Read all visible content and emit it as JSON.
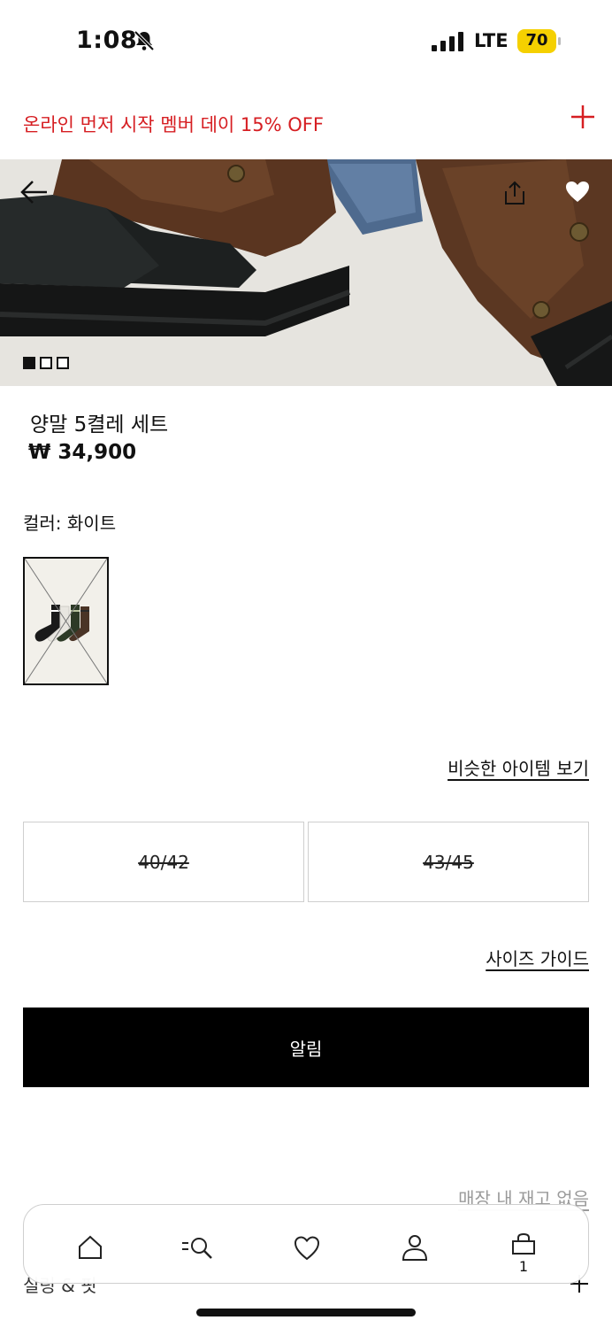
{
  "status_bar": {
    "time": "1:08",
    "network": "LTE",
    "battery": "70"
  },
  "promo": {
    "text": "온라인 먼저 시작 멤버 데이 15% OFF",
    "color": "#d61e22"
  },
  "hero": {
    "icons": [
      "back-arrow-icon",
      "share-icon",
      "heart-icon"
    ],
    "slides": 3,
    "active_slide": 1
  },
  "product": {
    "name": "양말 5켤레 세트",
    "price": "₩ 34,900"
  },
  "color": {
    "label": "컬러: 화이트"
  },
  "links": {
    "similar": "비슷한 아이템 보기",
    "size_guide": "사이즈 가이드"
  },
  "sizes": [
    {
      "label": "40/42",
      "available": false
    },
    {
      "label": "43/45",
      "available": false
    }
  ],
  "notify_button": "알림",
  "stock": {
    "text": "매장 내 재고 없음"
  },
  "section": {
    "label": "실링 & 핏"
  },
  "nav": {
    "items": [
      "home-icon",
      "search-icon",
      "wishlist-icon",
      "account-icon",
      "cart-icon"
    ],
    "cart_count": "1"
  }
}
